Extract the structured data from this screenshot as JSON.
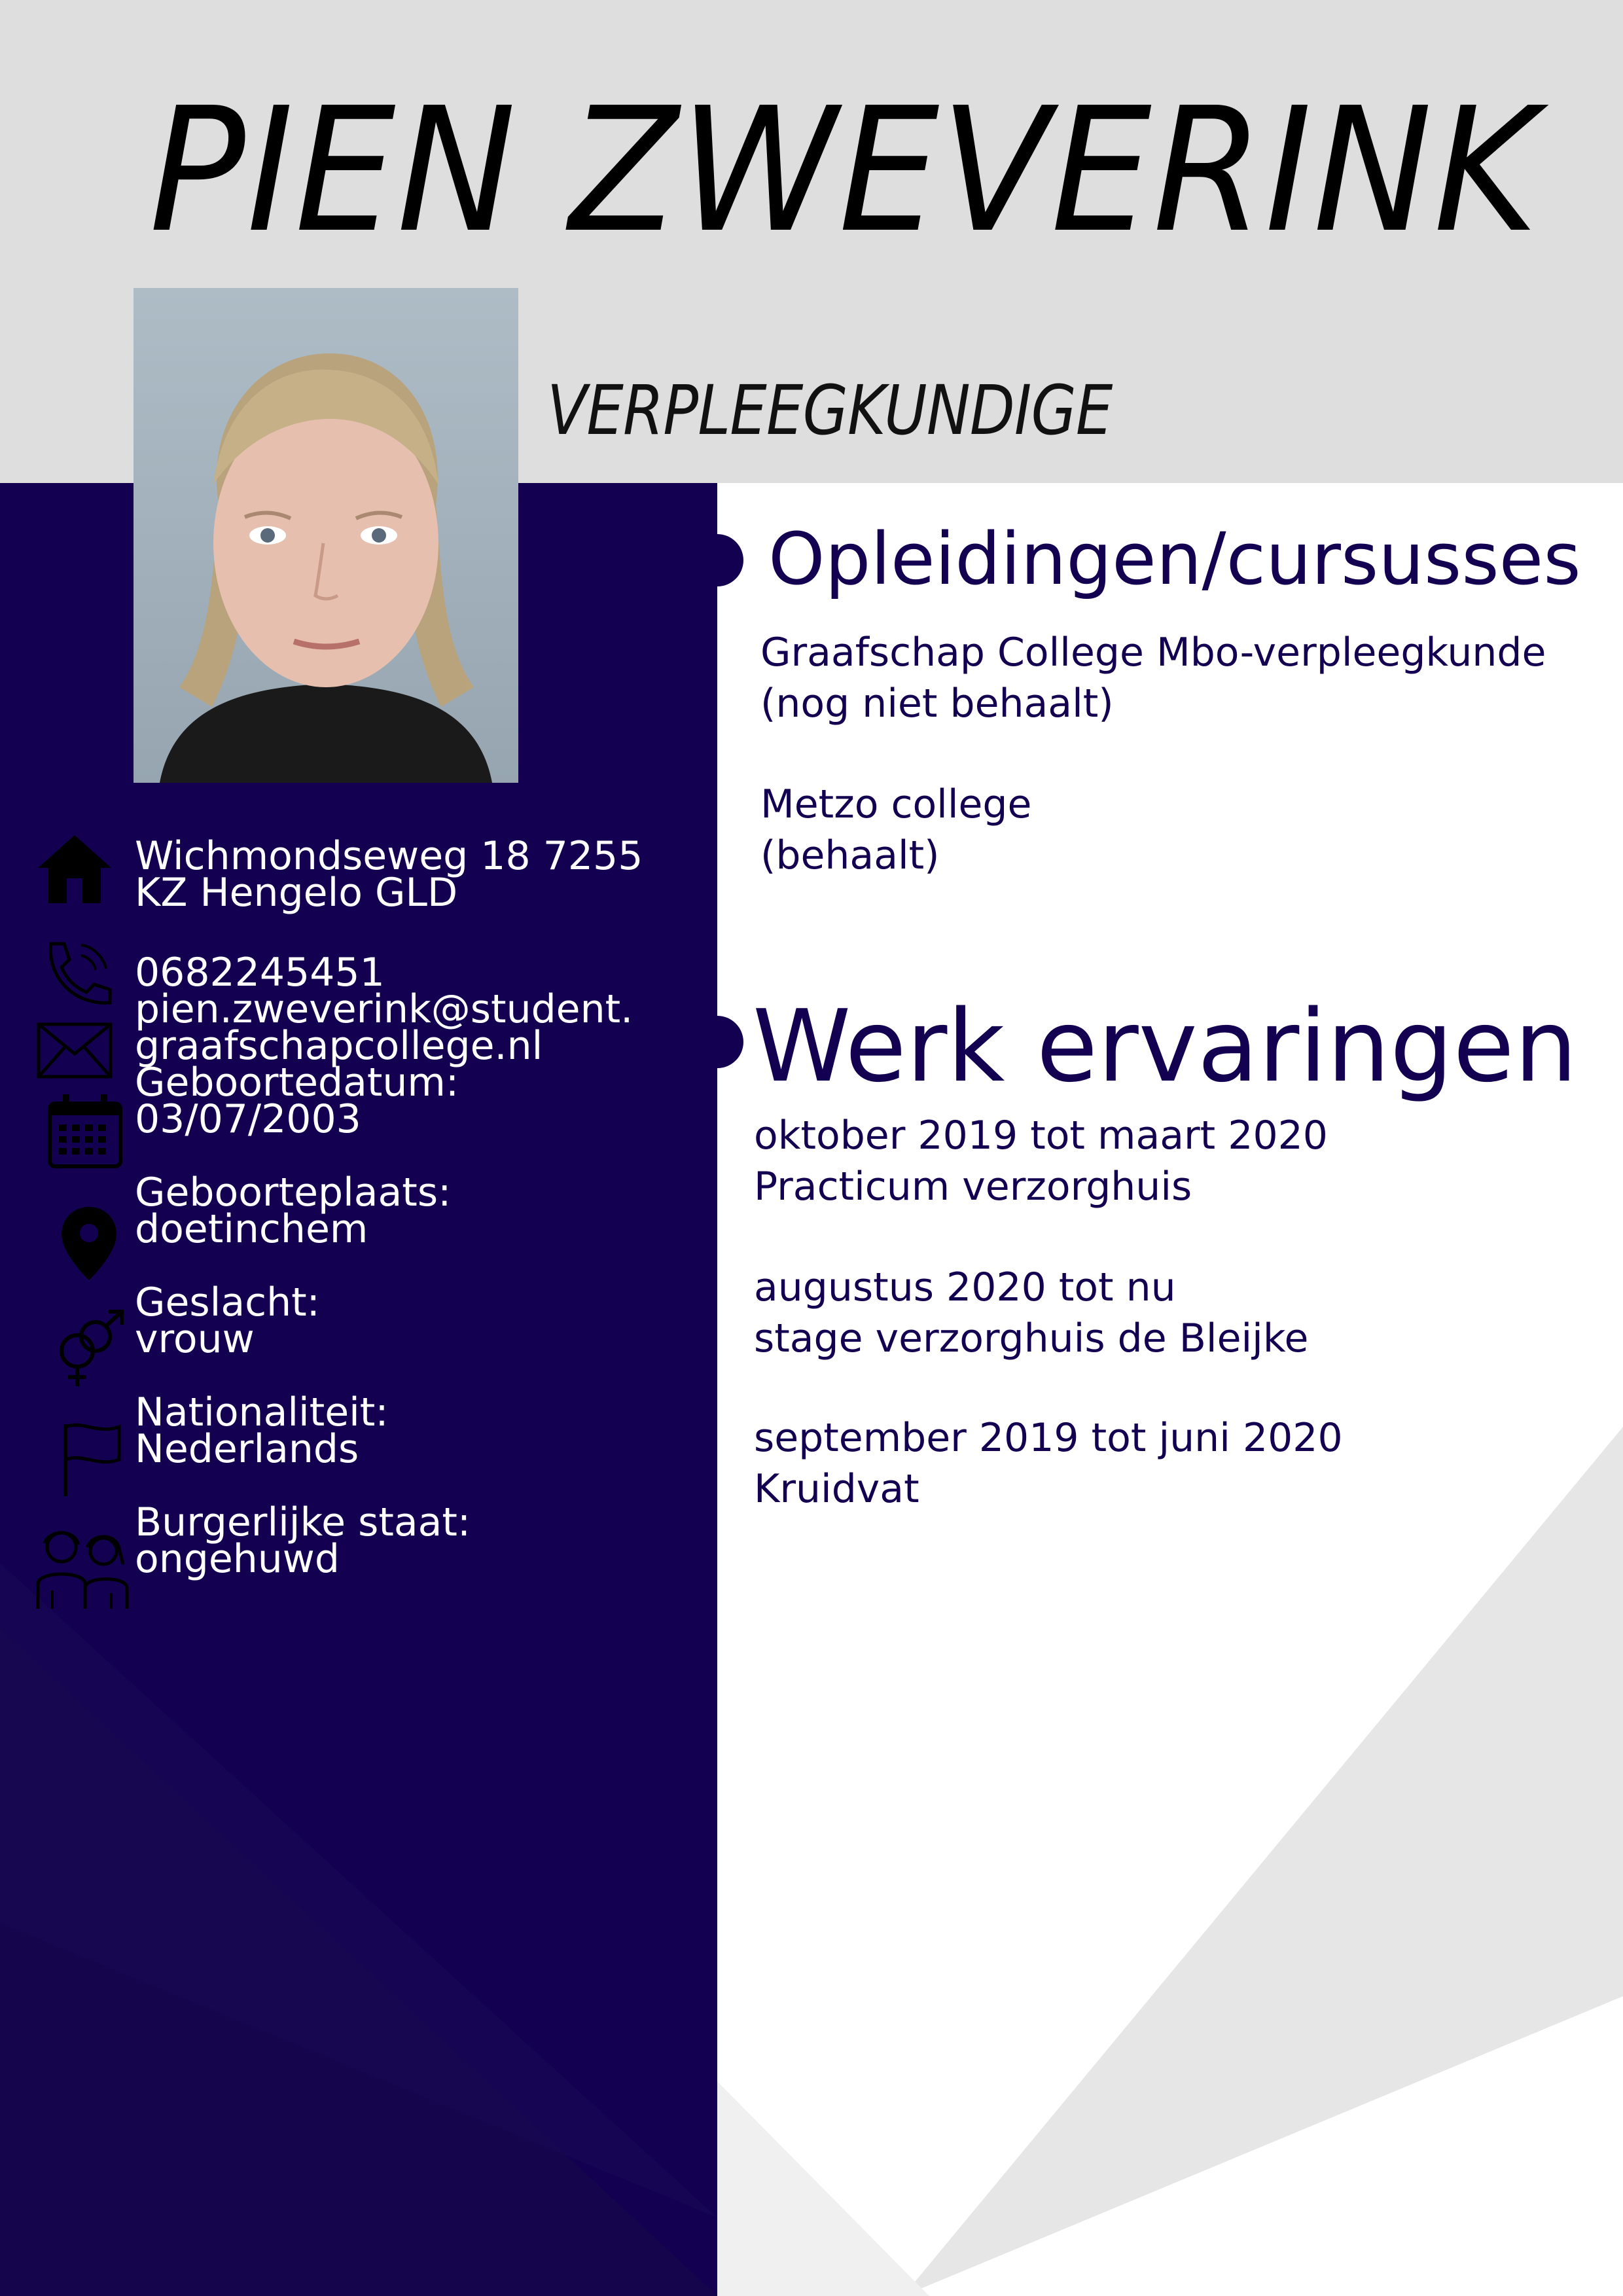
{
  "name": "PIEN ZWEVERINK",
  "job_title": "VERPLEEGKUNDIGE",
  "colors": {
    "navy": "#130050",
    "header_gray": "#dedede",
    "shape_gray": "#e6e6e6"
  },
  "contact": {
    "address": [
      "Wichmondseweg 18 7255",
      "KZ Hengelo GLD"
    ],
    "phone": "0682245451",
    "email": [
      "pien.zweverink@student.",
      "graafschapcollege.nl"
    ],
    "birthdate": [
      "Geboortedatum:",
      "03/07/2003"
    ],
    "birthplace": [
      "Geboorteplaats:",
      "doetinchem"
    ],
    "gender": [
      "Geslacht:",
      "vrouw"
    ],
    "nationality": [
      "Nationaliteit:",
      "Nederlands"
    ],
    "marital": [
      "Burgerlijke staat:",
      "ongehuwd"
    ]
  },
  "icons": [
    "home-icon",
    "phone-icon",
    "mail-icon",
    "calendar-icon",
    "location-pin-icon",
    "gender-icon",
    "flag-icon",
    "people-icon"
  ],
  "education": {
    "heading": "Opleidingen/cursusses",
    "items": [
      {
        "line1": "Graafschap College Mbo-verpleegkunde",
        "line2": "(nog niet behaalt)"
      },
      {
        "line1": "Metzo college",
        "line2": "(behaalt)"
      }
    ]
  },
  "work": {
    "heading": "Werk ervaringen",
    "items": [
      {
        "period": "oktober 2019 tot maart 2020",
        "place": "Practicum verzorghuis"
      },
      {
        "period": "augustus 2020 tot nu",
        "place": "stage verzorghuis de Bleijke"
      },
      {
        "period": "september 2019 tot juni 2020",
        "place": "Kruidvat"
      }
    ]
  }
}
